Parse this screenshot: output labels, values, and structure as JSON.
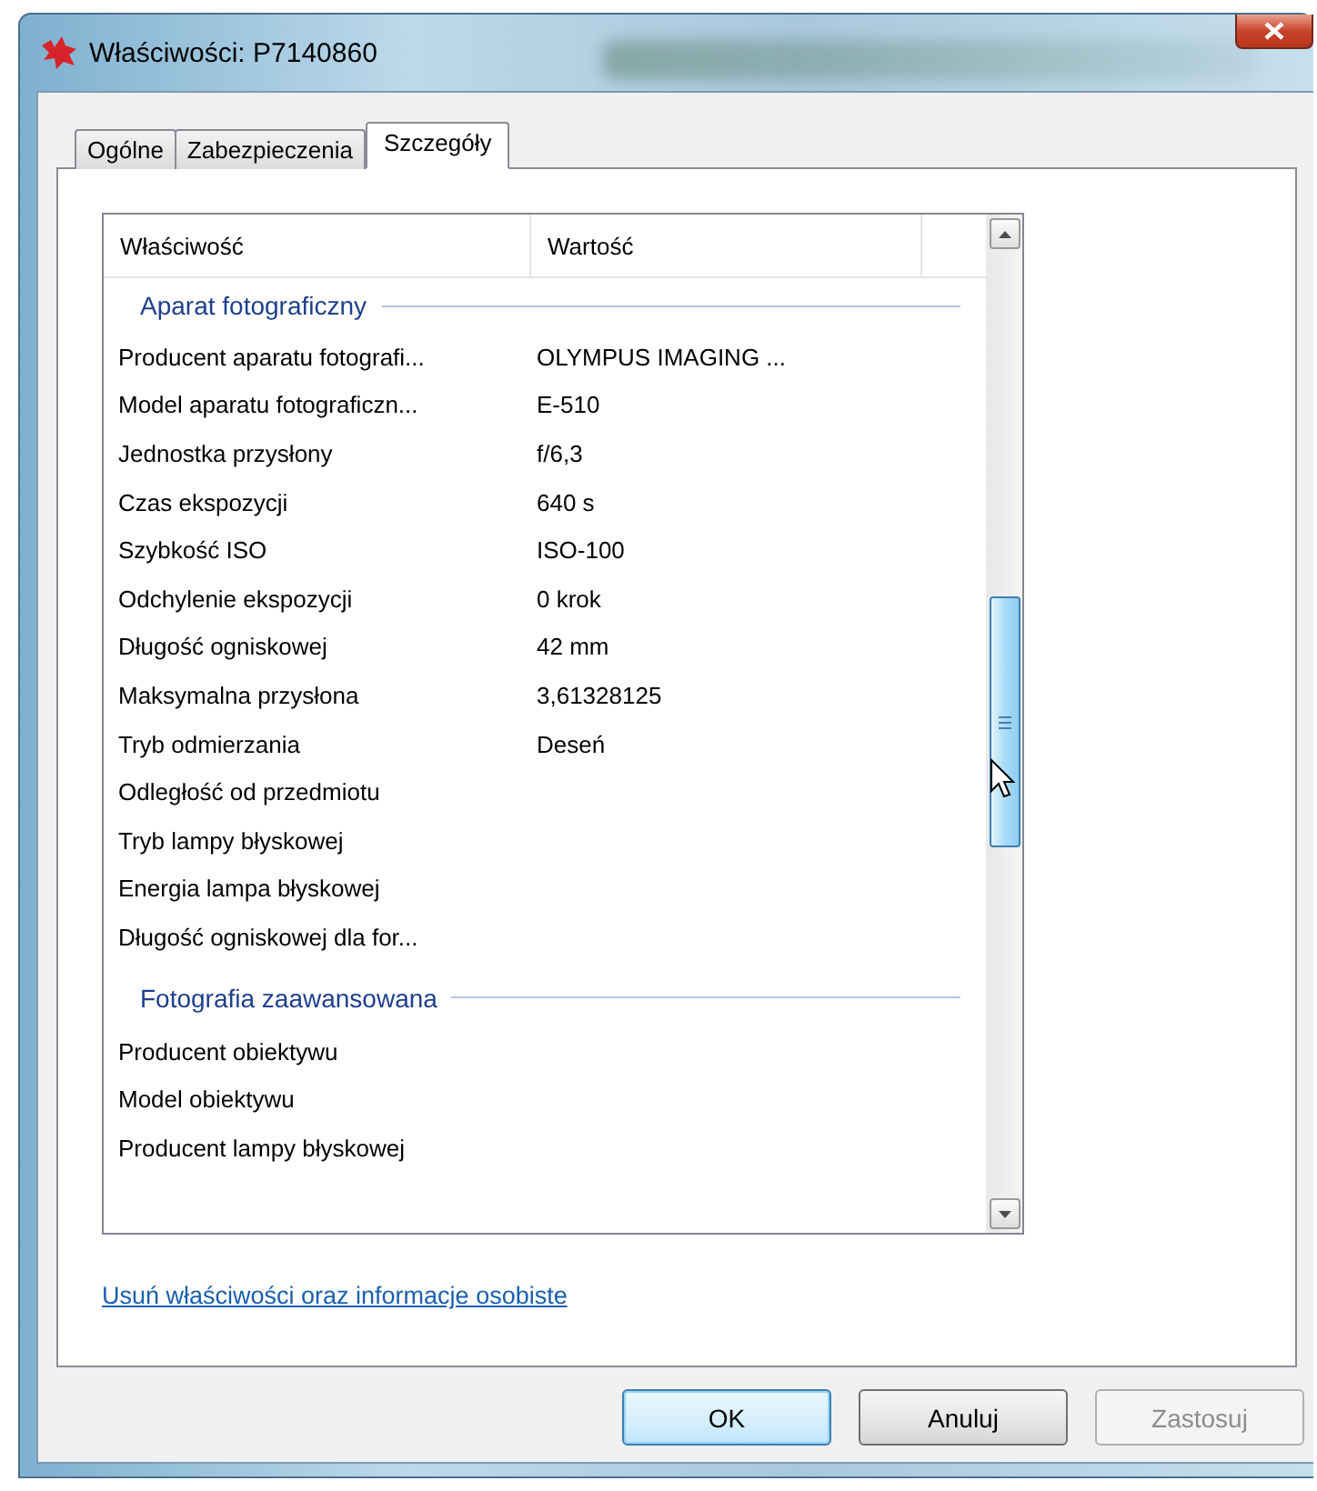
{
  "window": {
    "title": "Właściwości: P7140860"
  },
  "tabs": [
    {
      "label": "Ogólne",
      "selected": false
    },
    {
      "label": "Zabezpieczenia",
      "selected": false
    },
    {
      "label": "Szczegóły",
      "selected": true
    }
  ],
  "property_list": {
    "columns": [
      "Właściwość",
      "Wartość"
    ],
    "groups": [
      {
        "title": "Aparat fotograficzny",
        "rows": [
          {
            "property": "Producent aparatu fotografi...",
            "value": "OLYMPUS IMAGING ..."
          },
          {
            "property": "Model aparatu fotograficzn...",
            "value": "E-510"
          },
          {
            "property": "Jednostka przysłony",
            "value": "f/6,3"
          },
          {
            "property": "Czas ekspozycji",
            "value": "640 s"
          },
          {
            "property": "Szybkość ISO",
            "value": "ISO-100"
          },
          {
            "property": "Odchylenie ekspozycji",
            "value": "0 krok"
          },
          {
            "property": "Długość ogniskowej",
            "value": "42 mm"
          },
          {
            "property": "Maksymalna przysłona",
            "value": "3,61328125"
          },
          {
            "property": "Tryb odmierzania",
            "value": "Deseń"
          },
          {
            "property": "Odległość od przedmiotu"
          },
          {
            "property": "Tryb lampy błyskowej"
          },
          {
            "property": "Energia lampa błyskowej"
          },
          {
            "property": "Długość ogniskowej dla for..."
          }
        ]
      },
      {
        "title": "Fotografia zaawansowana",
        "rows": [
          {
            "property": "Producent obiektywu"
          },
          {
            "property": "Model obiektywu"
          },
          {
            "property": "Producent lampy błyskowej"
          }
        ]
      }
    ]
  },
  "link": "Usuń właściwości oraz informacje osobiste",
  "buttons": [
    {
      "label": "OK",
      "kind": "default",
      "disabled": false
    },
    {
      "label": "Anuluj",
      "kind": "normal",
      "disabled": false
    },
    {
      "label": "Zastosuj",
      "kind": "normal",
      "disabled": true
    }
  ]
}
